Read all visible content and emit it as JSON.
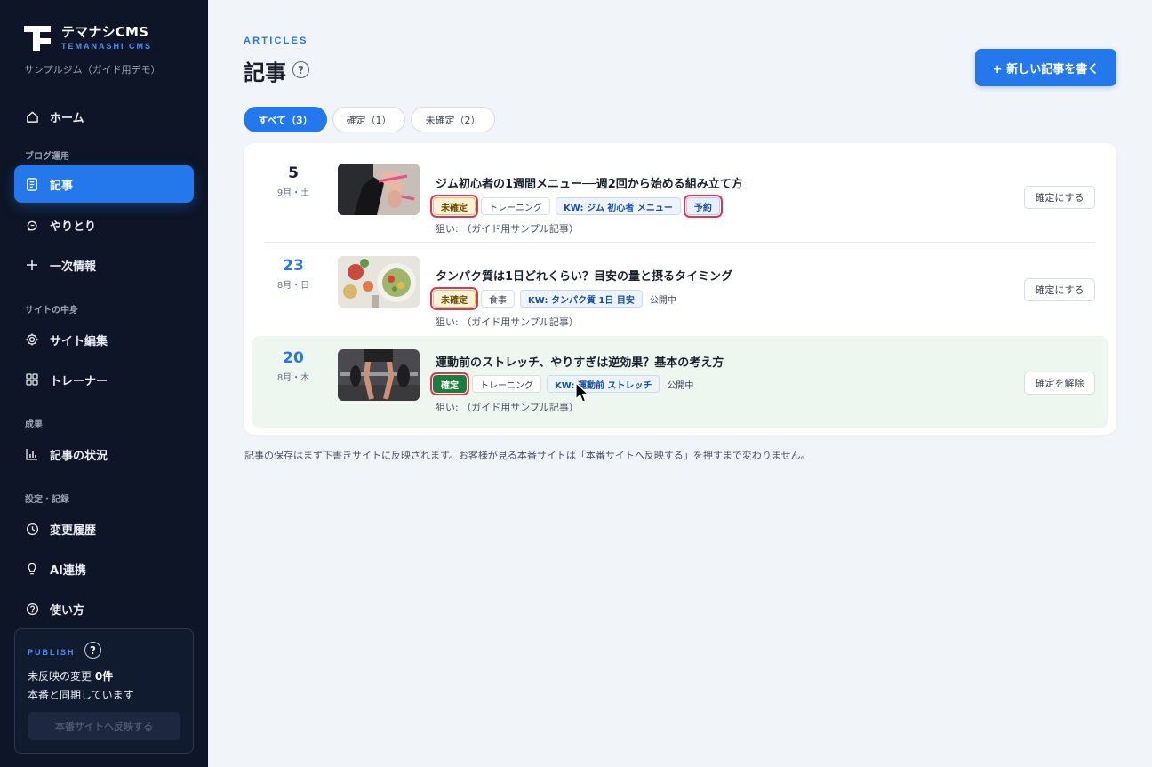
{
  "app": {
    "logo_title": "テマナシCMS",
    "logo_sub": "TEMANASHI CMS",
    "site_name": "サンプルジム（ガイド用デモ）"
  },
  "sidebar": {
    "home": "ホーム",
    "section_blog": "ブログ運用",
    "articles": "記事",
    "conversations": "やりとり",
    "primary_info": "一次情報",
    "section_site": "サイトの中身",
    "site_edit": "サイト編集",
    "trainers": "トレーナー",
    "section_results": "成果",
    "article_status": "記事の状況",
    "section_settings": "設定・記録",
    "history": "変更履歴",
    "ai": "AI連携",
    "howto": "使い方"
  },
  "publish": {
    "label": "PUBLISH",
    "help": "?",
    "pending_prefix": "未反映の変更 ",
    "pending_count": "0件",
    "synced": "本番と同期しています",
    "button": "本番サイトへ反映する"
  },
  "header": {
    "eyebrow": "ARTICLES",
    "title": "記事",
    "help": "?",
    "new_button": "+ 新しい記事を書く"
  },
  "filters": [
    {
      "label": "すべて（3）"
    },
    {
      "label": "確定（1）"
    },
    {
      "label": "未確定（2）"
    }
  ],
  "articles": [
    {
      "day": "5",
      "date_sub": "9月・土",
      "title": "ジム初心者の1週間メニュー──週2回から始める組み立て方",
      "status": "未確定",
      "category": "トレーニング",
      "keyword": "KW: ジム 初心者 メニュー",
      "state": "予約",
      "aim": "狙い: （ガイド用サンプル記事）",
      "action": "確定にする"
    },
    {
      "day": "23",
      "date_sub": "8月・日",
      "title": "タンパク質は1日どれくらい？目安の量と摂るタイミング",
      "status": "未確定",
      "category": "食事",
      "keyword": "KW: タンパク質 1日 目安",
      "state": "公開中",
      "aim": "狙い: （ガイド用サンプル記事）",
      "action": "確定にする"
    },
    {
      "day": "20",
      "date_sub": "8月・木",
      "title": "運動前のストレッチ、やりすぎは逆効果？基本の考え方",
      "status": "確定",
      "category": "トレーニング",
      "keyword": "KW: 運動前 ストレッチ",
      "state": "公開中",
      "aim": "狙い: （ガイド用サンプル記事）",
      "action": "確定を解除"
    }
  ],
  "footnote": "記事の保存はまず下書きサイトに反映されます。お客様が見る本番サイトは「本番サイトへ反映する」を押すまで変わりません。",
  "colors": {
    "accent": "#2478ec",
    "sidebar_bg": "#0d1526",
    "confirmed": "#1f7a3f",
    "pending_bg": "#fbf1d6",
    "highlight_outline": "#e1344f"
  }
}
